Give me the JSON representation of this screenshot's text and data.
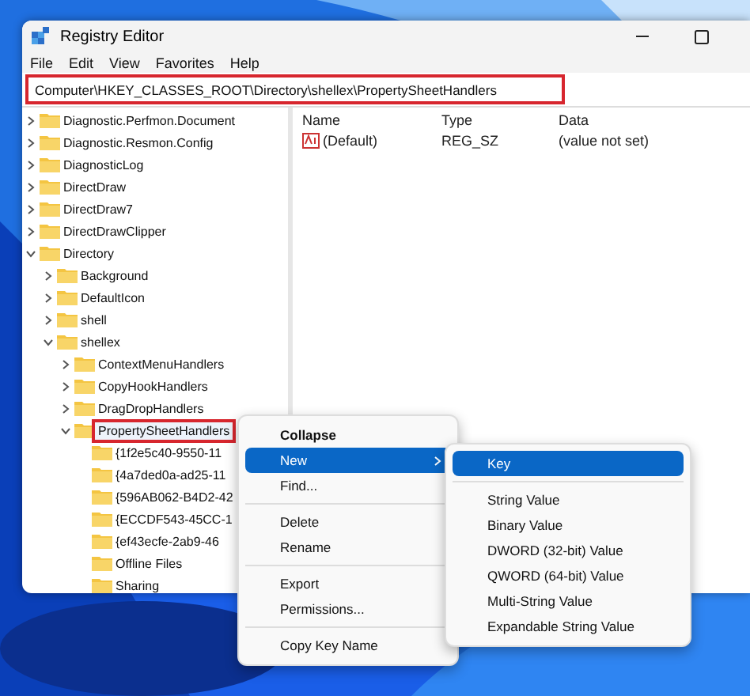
{
  "window": {
    "title": "Registry Editor"
  },
  "menu_bar": [
    "File",
    "Edit",
    "View",
    "Favorites",
    "Help"
  ],
  "address_bar": {
    "value": "Computer\\HKEY_CLASSES_ROOT\\Directory\\shellex\\PropertySheetHandlers",
    "highlighted": true
  },
  "tree": [
    {
      "label": "Diagnostic.Perfmon.Document",
      "expanded": false,
      "highlighted": false
    },
    {
      "label": "Diagnostic.Resmon.Config",
      "expanded": false,
      "highlighted": false
    },
    {
      "label": "DiagnosticLog",
      "expanded": false,
      "highlighted": false
    },
    {
      "label": "DirectDraw",
      "expanded": false,
      "highlighted": false
    },
    {
      "label": "DirectDraw7",
      "expanded": false,
      "highlighted": false
    },
    {
      "label": "DirectDrawClipper",
      "expanded": false,
      "highlighted": false
    },
    {
      "label": "Directory",
      "expanded": true,
      "highlighted": false,
      "children": [
        {
          "label": "Background",
          "expanded": false,
          "highlighted": false
        },
        {
          "label": "DefaultIcon",
          "expanded": false,
          "highlighted": false
        },
        {
          "label": "shell",
          "expanded": false,
          "highlighted": false
        },
        {
          "label": "shellex",
          "expanded": true,
          "highlighted": false,
          "children": [
            {
              "label": "ContextMenuHandlers",
              "expanded": false,
              "highlighted": false
            },
            {
              "label": "CopyHookHandlers",
              "expanded": false,
              "highlighted": false
            },
            {
              "label": "DragDropHandlers",
              "expanded": false,
              "highlighted": false
            },
            {
              "label": "PropertySheetHandlers",
              "expanded": true,
              "highlighted": true,
              "children": [
                {
                  "label": "{1f2e5c40-9550-11",
                  "highlighted": false
                },
                {
                  "label": "{4a7ded0a-ad25-11",
                  "highlighted": false
                },
                {
                  "label": "{596AB062-B4D2-42",
                  "highlighted": false
                },
                {
                  "label": "{ECCDF543-45CC-1",
                  "highlighted": false
                },
                {
                  "label": "{ef43ecfe-2ab9-46",
                  "highlighted": false
                },
                {
                  "label": "Offline Files",
                  "highlighted": false
                },
                {
                  "label": "Sharing",
                  "highlighted": false
                }
              ]
            }
          ]
        }
      ]
    }
  ],
  "values_table": {
    "columns": [
      "Name",
      "Type",
      "Data"
    ],
    "rows": [
      {
        "name": "(Default)",
        "type": "REG_SZ",
        "data": "(value not set)"
      }
    ]
  },
  "context_menu": [
    {
      "label": "Collapse",
      "bold": true,
      "selected": false
    },
    {
      "label": "New",
      "selected": true,
      "submenu": true
    },
    {
      "label": "Find...",
      "selected": false
    },
    {
      "kind": "separator"
    },
    {
      "label": "Delete",
      "selected": false
    },
    {
      "label": "Rename",
      "selected": false
    },
    {
      "kind": "separator"
    },
    {
      "label": "Export",
      "selected": false
    },
    {
      "label": "Permissions...",
      "selected": false
    },
    {
      "kind": "separator"
    },
    {
      "label": "Copy Key Name",
      "selected": false
    }
  ],
  "submenu": [
    {
      "label": "Key",
      "selected": true
    },
    {
      "kind": "separator"
    },
    {
      "label": "String Value",
      "selected": false
    },
    {
      "label": "Binary Value",
      "selected": false
    },
    {
      "label": "DWORD (32-bit) Value",
      "selected": false
    },
    {
      "label": "QWORD (64-bit) Value",
      "selected": false
    },
    {
      "label": "Multi-String Value",
      "selected": false
    },
    {
      "label": "Expandable String Value",
      "selected": false
    }
  ]
}
